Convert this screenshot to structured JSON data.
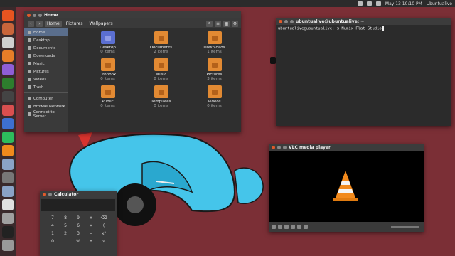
{
  "topbar": {
    "datetime": "May 13 10:10 PM",
    "user": "Ubuntualive"
  },
  "launcher": {
    "icons": [
      {
        "name": "ubuntu-icon",
        "color": "#e95420"
      },
      {
        "name": "files-icon",
        "color": "#c8653b"
      },
      {
        "name": "chrome-icon",
        "color": "#cfcfcf"
      },
      {
        "name": "firefox-icon",
        "color": "#e77d28"
      },
      {
        "name": "writer-icon",
        "color": "#8f5ed6"
      },
      {
        "name": "calc-icon",
        "color": "#2d7d2d"
      },
      {
        "name": "inkscape-icon",
        "color": "#444444"
      },
      {
        "name": "app-icon",
        "color": "#d94f4f"
      },
      {
        "name": "blue-app-icon",
        "color": "#3d6fcf"
      },
      {
        "name": "spotify-icon",
        "color": "#2dbd5c"
      },
      {
        "name": "vlc-icon",
        "color": "#f08a1c"
      },
      {
        "name": "camera-icon",
        "color": "#8aa3c7"
      },
      {
        "name": "tools-icon",
        "color": "#777777"
      },
      {
        "name": "camera2-icon",
        "color": "#8aa3c7"
      },
      {
        "name": "software-icon",
        "color": "#e0e0e0"
      },
      {
        "name": "settings-icon",
        "color": "#a0a0a0"
      },
      {
        "name": "terminal-icon",
        "color": "#222222"
      },
      {
        "name": "trash-icon",
        "color": "#999999"
      }
    ]
  },
  "files": {
    "title": "Home",
    "breadcrumbs": [
      "Home",
      "Pictures",
      "Wallpapers"
    ],
    "sidebar": [
      "Home",
      "Desktop",
      "Documents",
      "Downloads",
      "Music",
      "Pictures",
      "Videos",
      "Trash"
    ],
    "sidebar2": [
      "Computer",
      "Browse Network",
      "Connect to Server"
    ],
    "items": [
      {
        "name": "Desktop",
        "sub": "0 items",
        "type": "desktop"
      },
      {
        "name": "Documents",
        "sub": "2 items",
        "type": "folder"
      },
      {
        "name": "Downloads",
        "sub": "1 items",
        "type": "folder"
      },
      {
        "name": "Dropbox",
        "sub": "0 items",
        "type": "folder"
      },
      {
        "name": "Music",
        "sub": "8 items",
        "type": "folder"
      },
      {
        "name": "Pictures",
        "sub": "3 items",
        "type": "folder"
      },
      {
        "name": "Public",
        "sub": "0 items",
        "type": "folder"
      },
      {
        "name": "Templates",
        "sub": "0 items",
        "type": "folder"
      },
      {
        "name": "Videos",
        "sub": "0 items",
        "type": "folder"
      }
    ]
  },
  "terminal": {
    "title": "ubuntualive@ubuntualive: ~",
    "prompt": "ubuntualive@ubuntualive:~$ ",
    "command": "Numix Flat Studio"
  },
  "vlc": {
    "title": "VLC media player"
  },
  "calculator": {
    "title": "Calculator",
    "keys": [
      "7",
      "8",
      "9",
      "÷",
      "⌫",
      "4",
      "5",
      "6",
      "×",
      "(",
      "1",
      "2",
      "3",
      "−",
      "x²",
      "0",
      ".",
      "%",
      "+",
      "√"
    ]
  }
}
